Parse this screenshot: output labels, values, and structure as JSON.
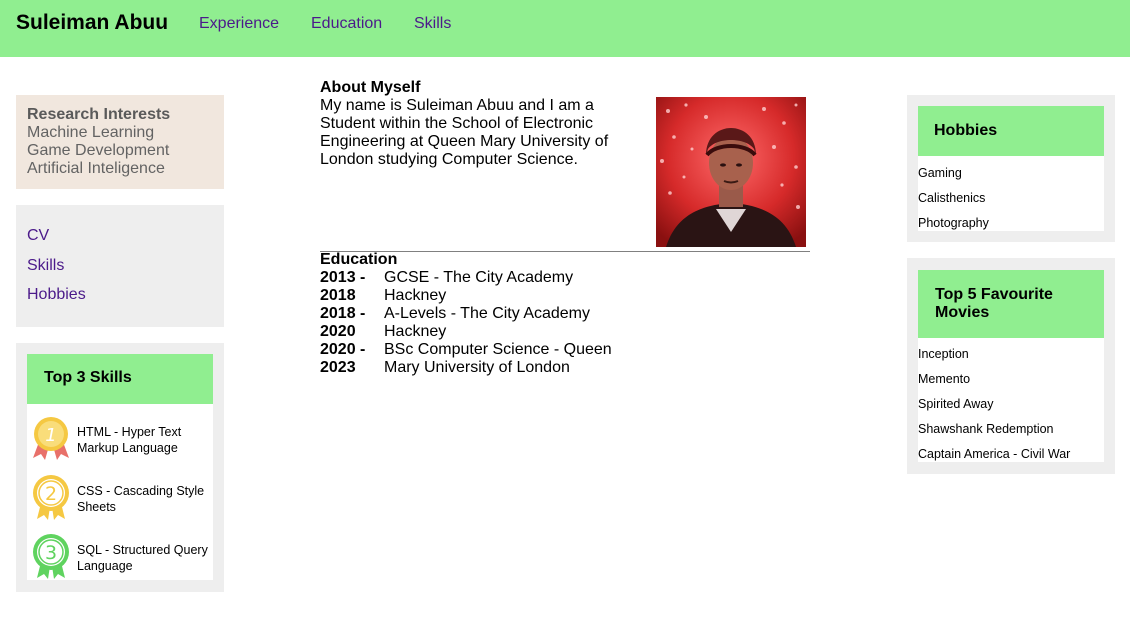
{
  "header": {
    "title": "Suleiman Abuu",
    "nav": [
      "Experience",
      "Education",
      "Skills"
    ]
  },
  "research": {
    "title": "Research Interests",
    "items": [
      "Machine Learning",
      "Game Development",
      "Artificial Inteligence"
    ]
  },
  "quick_links": [
    "CV",
    "Skills",
    "Hobbies"
  ],
  "top_skills": {
    "title": "Top 3 Skills",
    "items": [
      {
        "rank": "1",
        "label": "HTML - Hyper Text Markup Language"
      },
      {
        "rank": "2",
        "label": "CSS - Cascading Style Sheets"
      },
      {
        "rank": "3",
        "label": "SQL - Structured Query Language"
      }
    ]
  },
  "about": {
    "title": "About Myself",
    "text": "My name is Suleiman Abuu and I am a Student within the School of Electronic Engineering at Queen Mary University of London studying Computer Science."
  },
  "education": {
    "title": "Education",
    "rows": [
      {
        "years": [
          "2013 -",
          "2018"
        ],
        "desc": [
          "GCSE - The City Academy",
          "Hackney"
        ]
      },
      {
        "years": [
          "2018 -",
          "2020"
        ],
        "desc": [
          "A-Levels - The City Academy",
          "Hackney"
        ]
      },
      {
        "years": [
          "2020 -",
          "2023"
        ],
        "desc": [
          "BSc Computer Science - Queen",
          "Mary University of London"
        ]
      }
    ]
  },
  "hobbies": {
    "title": "Hobbies",
    "items": [
      "Gaming",
      "Calisthenics",
      "Photography"
    ]
  },
  "movies": {
    "title": "Top 5 Favourite Movies",
    "items": [
      "Inception",
      "Memento",
      "Spirited Away",
      "Shawshank Redemption",
      "Captain America - Civil War"
    ]
  },
  "colors": {
    "header_green": "#90ee90",
    "link_purple": "#4b1a8a",
    "panel_grey": "#eeeeee",
    "research_beige": "#f1e7de",
    "medal_gold": "#f5c842",
    "medal_green": "#5fd35f"
  }
}
